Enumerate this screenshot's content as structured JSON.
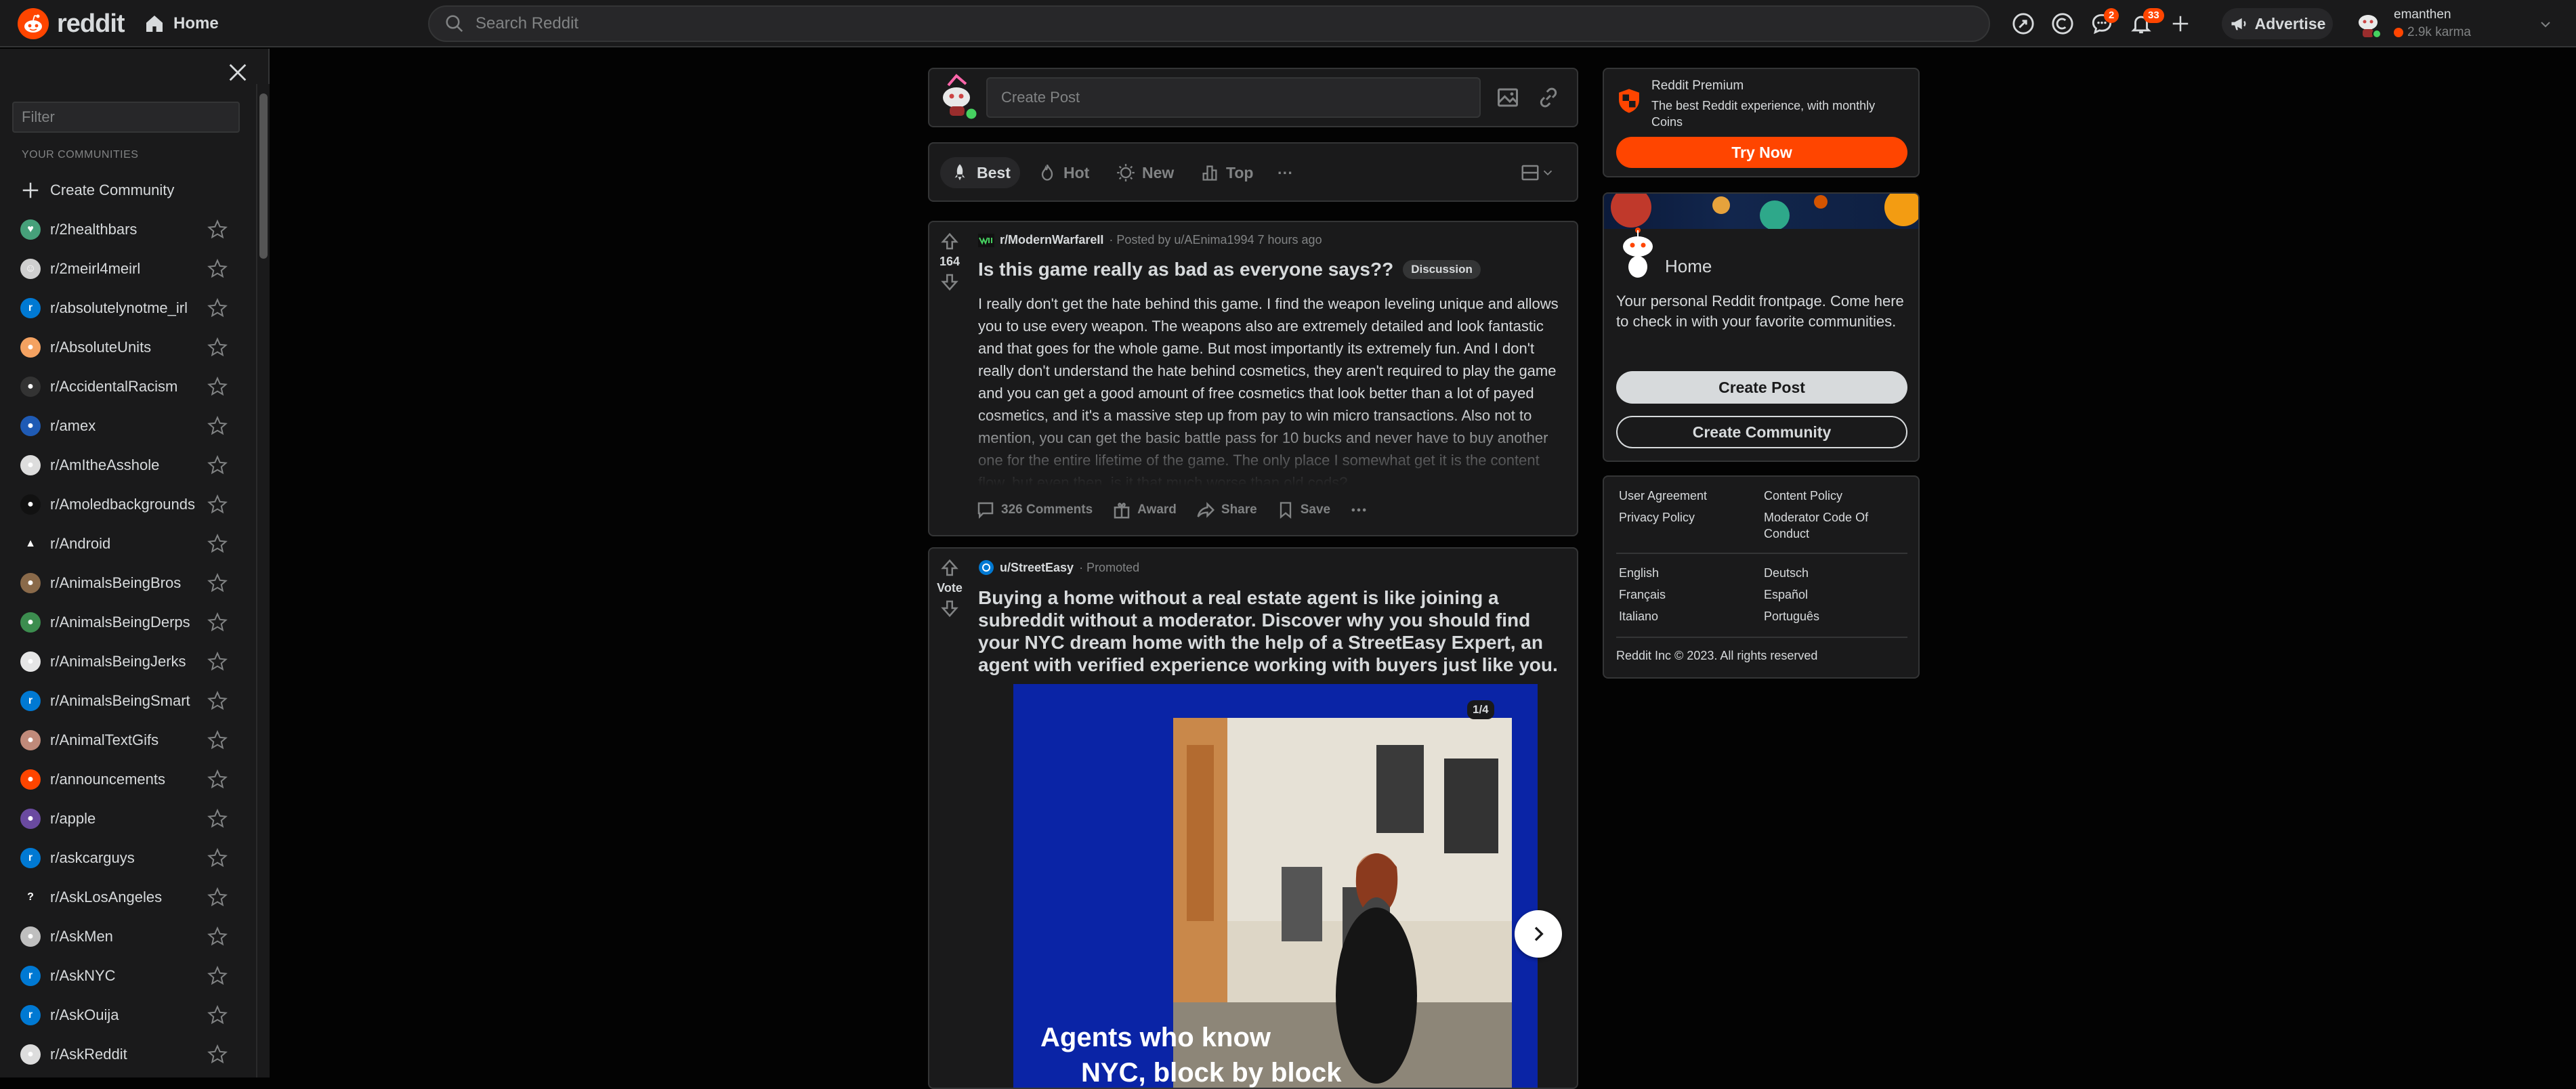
{
  "header": {
    "logo_text": "reddit",
    "home_label": "Home",
    "search_placeholder": "Search Reddit",
    "chat_badge": "2",
    "notif_badge": "33",
    "advertise_label": "Advertise",
    "username": "emanthen",
    "karma": "2.9k karma"
  },
  "sidebar": {
    "filter_placeholder": "Filter",
    "heading": "YOUR COMMUNITIES",
    "create_label": "Create Community",
    "communities": [
      {
        "name": "r/2healthbars",
        "color": "#46a07a",
        "glyph": "♥"
      },
      {
        "name": "r/2meirl4meirl",
        "color": "#cfcfcf",
        "glyph": "☺"
      },
      {
        "name": "r/absolutelynotme_irl",
        "color": "#0079d3",
        "glyph": "r"
      },
      {
        "name": "r/AbsoluteUnits",
        "color": "#f4a261",
        "glyph": "●"
      },
      {
        "name": "r/AccidentalRacism",
        "color": "#333333",
        "glyph": "●"
      },
      {
        "name": "r/amex",
        "color": "#1f5bb5",
        "glyph": "●"
      },
      {
        "name": "r/AmItheAsshole",
        "color": "#dddddd",
        "glyph": "●"
      },
      {
        "name": "r/Amoledbackgrounds",
        "color": "#111111",
        "glyph": "●"
      },
      {
        "name": "r/Android",
        "color": "#1a1a1b",
        "glyph": "▲"
      },
      {
        "name": "r/AnimalsBeingBros",
        "color": "#8a6a4a",
        "glyph": "●"
      },
      {
        "name": "r/AnimalsBeingDerps",
        "color": "#3c8d4f",
        "glyph": "●"
      },
      {
        "name": "r/AnimalsBeingJerks",
        "color": "#e6e6e6",
        "glyph": "●"
      },
      {
        "name": "r/AnimalsBeingSmart",
        "color": "#0079d3",
        "glyph": "r"
      },
      {
        "name": "r/AnimalTextGifs",
        "color": "#c08a7a",
        "glyph": "●"
      },
      {
        "name": "r/announcements",
        "color": "#ff4500",
        "glyph": "●"
      },
      {
        "name": "r/apple",
        "color": "#6a4aa0",
        "glyph": "●"
      },
      {
        "name": "r/askcarguys",
        "color": "#0079d3",
        "glyph": "r"
      },
      {
        "name": "r/AskLosAngeles",
        "color": "#1a1a1b",
        "glyph": "?"
      },
      {
        "name": "r/AskMen",
        "color": "#bfbfbf",
        "glyph": "●"
      },
      {
        "name": "r/AskNYC",
        "color": "#0079d3",
        "glyph": "r"
      },
      {
        "name": "r/AskOuija",
        "color": "#0079d3",
        "glyph": "r"
      },
      {
        "name": "r/AskReddit",
        "color": "#dddddd",
        "glyph": "●"
      }
    ]
  },
  "create_post": {
    "placeholder": "Create Post"
  },
  "sort": {
    "best": "Best",
    "hot": "Hot",
    "new": "New",
    "top": "Top",
    "more": "···"
  },
  "post1": {
    "votes": "164",
    "subreddit": "r/ModernWarfareII",
    "posted_by": "· Posted by u/AEnima1994 7 hours ago",
    "title": "Is this game really as bad as everyone says??",
    "flair": "Discussion",
    "body": "I really don't get the hate behind this game. I find the weapon leveling unique and allows you to use every weapon. The weapons also are extremely detailed and look fantastic and that goes for the whole game. But most importantly its extremely fun. And I don't really don't understand the hate behind cosmetics, they aren't required to play the game and you can get a good amount of free cosmetics that look better than a lot of payed cosmetics, and it's a massive step up from pay to win micro transactions. Also not to mention, you can get the basic battle pass for 10 bucks and never have to buy another one for the entire lifetime of the game. The only place I somewhat get it is the content flow, but even then, is it that much worse than old cods?",
    "comments": "326 Comments",
    "award": "Award",
    "share": "Share",
    "save": "Save"
  },
  "post2": {
    "vote_label": "Vote",
    "author": "u/StreetEasy",
    "promoted": "· Promoted",
    "title": "Buying a home without a real estate agent is like joining a subreddit without a moderator. Discover why you should find your NYC dream home with the help of a StreetEasy Expert, an agent with verified experience working with buyers just like you.",
    "counter": "1/4",
    "img_line1": "Agents who know",
    "img_line2": "NYC, block by block"
  },
  "premium": {
    "title": "Reddit Premium",
    "desc": "The best Reddit experience, with monthly Coins",
    "button": "Try Now"
  },
  "homecard": {
    "title": "Home",
    "desc": "Your personal Reddit frontpage. Come here to check in with your favorite communities.",
    "create_post": "Create Post",
    "create_community": "Create Community"
  },
  "footer": {
    "user_agreement": "User Agreement",
    "content_policy": "Content Policy",
    "privacy_policy": "Privacy Policy",
    "moderator_code": "Moderator Code Of Conduct",
    "langs": [
      "English",
      "Deutsch",
      "Français",
      "Español",
      "Italiano",
      "Português"
    ],
    "copyright": "Reddit Inc © 2023. All rights reserved"
  },
  "colors": {
    "accent": "#ff4500",
    "background": "#030303",
    "card": "#1a1a1b",
    "border": "#343536"
  }
}
